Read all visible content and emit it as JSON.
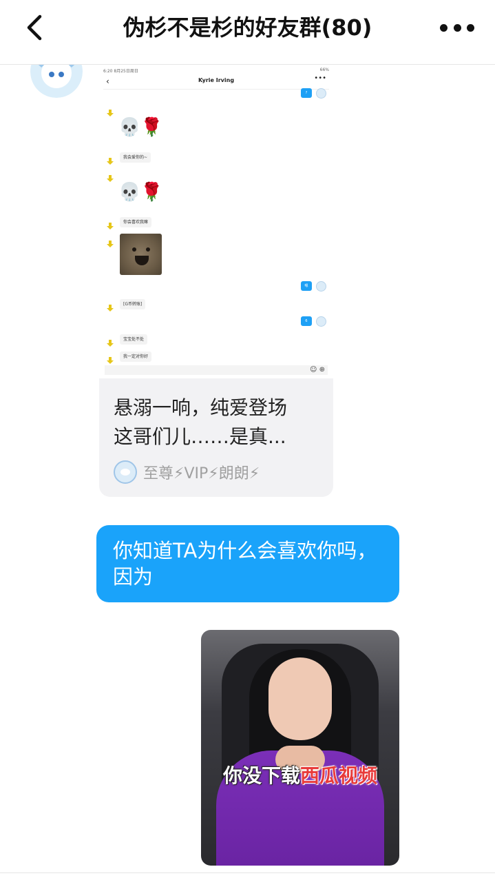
{
  "header": {
    "title": "伪杉不是杉的好友群(80)"
  },
  "quoted_card": {
    "inner_screenshot": {
      "status_left": "6:20  8月25日周日",
      "status_right": "66%",
      "contact_name": "Kyrie Irving",
      "messages": [
        "我会爱你的~",
        "你会喜欢我嘛",
        "[G币转账]",
        "宝宝处不处",
        "我一定对你好"
      ],
      "emoji_1": "💀🌹",
      "emoji_2": "💀🌹",
      "sent_labels": [
        "?",
        "嗯",
        "6"
      ]
    },
    "text_line_1": "悬溺一响，纯爱登场",
    "text_line_2": "这哥们儿……是真...",
    "source_name": "至尊⚡VIP⚡朗朗⚡"
  },
  "message": {
    "text": "你知道TA为什么会喜欢你吗，因为"
  },
  "video": {
    "caption_white": "你没下载",
    "caption_red": "西瓜视频"
  },
  "colors": {
    "bubble_blue": "#1aa3fa",
    "card_bg": "#f2f2f4",
    "suit_purple": "#6a24a3"
  }
}
